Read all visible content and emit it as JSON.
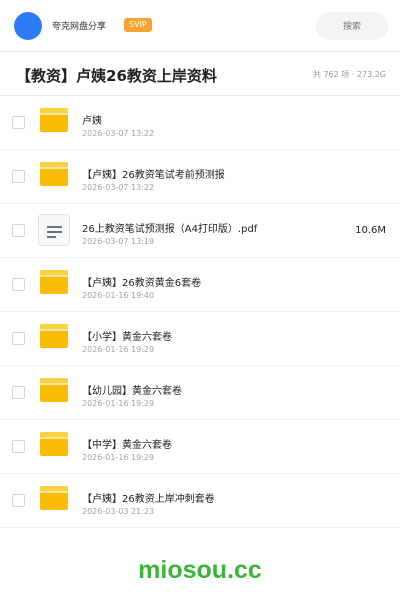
{
  "header": {
    "share_name": "夸克网盘分享",
    "badge": "SVIP",
    "search_placeholder": "搜索",
    "avatar_color": "#2f7bf6",
    "badge_color": "#f7a530"
  },
  "title_bar": {
    "title": "【教资】卢姨26教资上岸资料",
    "summary": "共 762 项 · 273.2G"
  },
  "files": [
    {
      "name": "卢姨",
      "date": "2026-03-07 13:22",
      "type": "folder",
      "size": ""
    },
    {
      "name": "【卢姨】26教资笔试考前预测报",
      "date": "2026-03-07 13:22",
      "type": "folder",
      "size": ""
    },
    {
      "name": "26上教资笔试预测报（A4打印版）.pdf",
      "date": "2026-03-07 13:19",
      "type": "document",
      "size": "10.6M"
    },
    {
      "name": "【卢姨】26教资黄金6套卷",
      "date": "2026-01-16 19:40",
      "type": "folder",
      "size": ""
    },
    {
      "name": "【小学】黄金六套卷",
      "date": "2026-01-16 19:29",
      "type": "folder",
      "size": ""
    },
    {
      "name": "【幼儿园】黄金六套卷",
      "date": "2026-01-16 19:29",
      "type": "folder",
      "size": ""
    },
    {
      "name": "【中学】黄金六套卷",
      "date": "2026-01-16 19:29",
      "type": "folder",
      "size": ""
    },
    {
      "name": "【卢姨】26教资上岸冲刺套卷",
      "date": "2026-03-03 21:23",
      "type": "folder",
      "size": ""
    }
  ],
  "icons": {
    "folder": "folder-icon",
    "document": "document-icon"
  },
  "watermark": "miosou.cc",
  "watermark_color": "#3ab53a"
}
